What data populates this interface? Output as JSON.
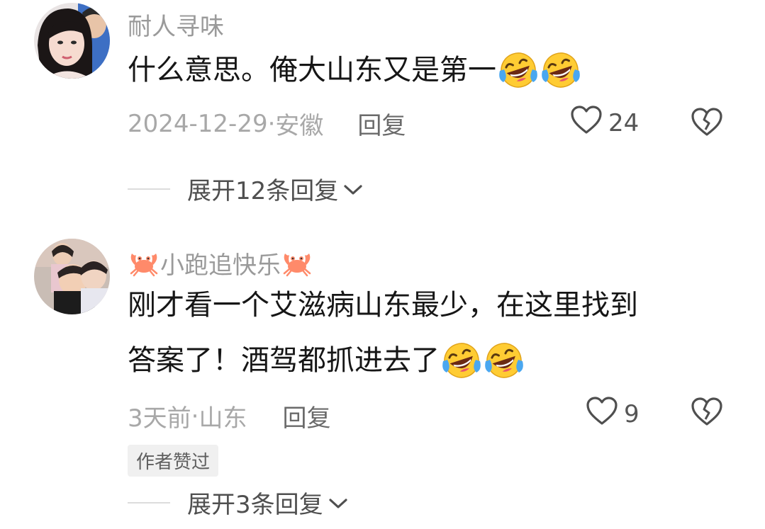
{
  "comments": [
    {
      "username": "耐人寻味",
      "content_lines": [
        "什么意思。俺大山东又是第一"
      ],
      "content_emojis": [
        2
      ],
      "date": "2024-12-29",
      "location": "安徽",
      "separator": " · ",
      "reply_label": "回复",
      "like_count": "24",
      "expand_label": "展开12条回复"
    },
    {
      "username": "小跑追快乐",
      "username_decoration": "crab-emoji",
      "content_lines": [
        "刚才看一个艾滋病山东最少，在这里找到",
        "答案了！酒驾都抓进去了"
      ],
      "content_emojis": [
        0,
        2
      ],
      "date": "3天前",
      "location": "山东",
      "separator": " · ",
      "reply_label": "回复",
      "like_count": "9",
      "author_badge": "作者赞过",
      "expand_label": "展开3条回复"
    }
  ],
  "icons": {
    "like": "heart-outline-icon",
    "dislike": "broken-heart-icon",
    "expand": "chevron-down-icon",
    "emoji": "rolling-on-floor-laughing-emoji"
  },
  "colors": {
    "username": "#9a9a9a",
    "content": "#161616",
    "meta": "#a8a8a8",
    "reply": "#6a6a6a",
    "badge_bg": "#f0f0f0"
  }
}
